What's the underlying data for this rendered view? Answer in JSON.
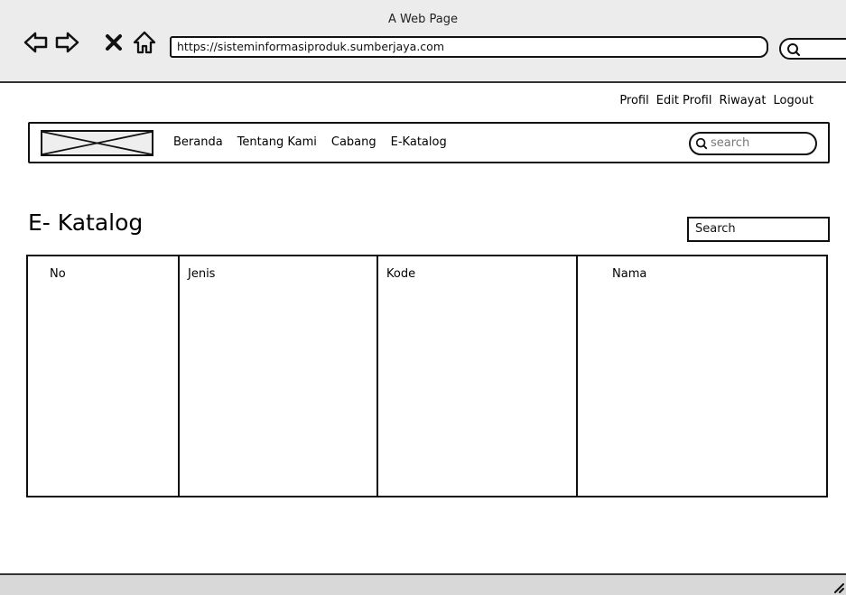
{
  "browser": {
    "window_title": "A Web Page",
    "url": "https://sisteminformasiproduk.sumberjaya.com",
    "back_icon": "back-arrow-icon",
    "forward_icon": "forward-arrow-icon",
    "stop_icon": "close-icon",
    "home_icon": "home-icon",
    "search_icon": "search-icon"
  },
  "user_menu": {
    "items": [
      {
        "label": "Profil"
      },
      {
        "label": "Edit Profil"
      },
      {
        "label": "Riwayat"
      },
      {
        "label": "Logout"
      }
    ]
  },
  "navbar": {
    "logo": "image-placeholder",
    "links": [
      {
        "label": "Beranda"
      },
      {
        "label": "Tentang Kami"
      },
      {
        "label": "Cabang"
      },
      {
        "label": "E-Katalog"
      }
    ],
    "search_placeholder": "search"
  },
  "main": {
    "title": "E- Katalog",
    "search_label": "Search",
    "table": {
      "columns": [
        "No",
        "Jenis",
        "Kode",
        "Nama"
      ],
      "rows": []
    }
  }
}
